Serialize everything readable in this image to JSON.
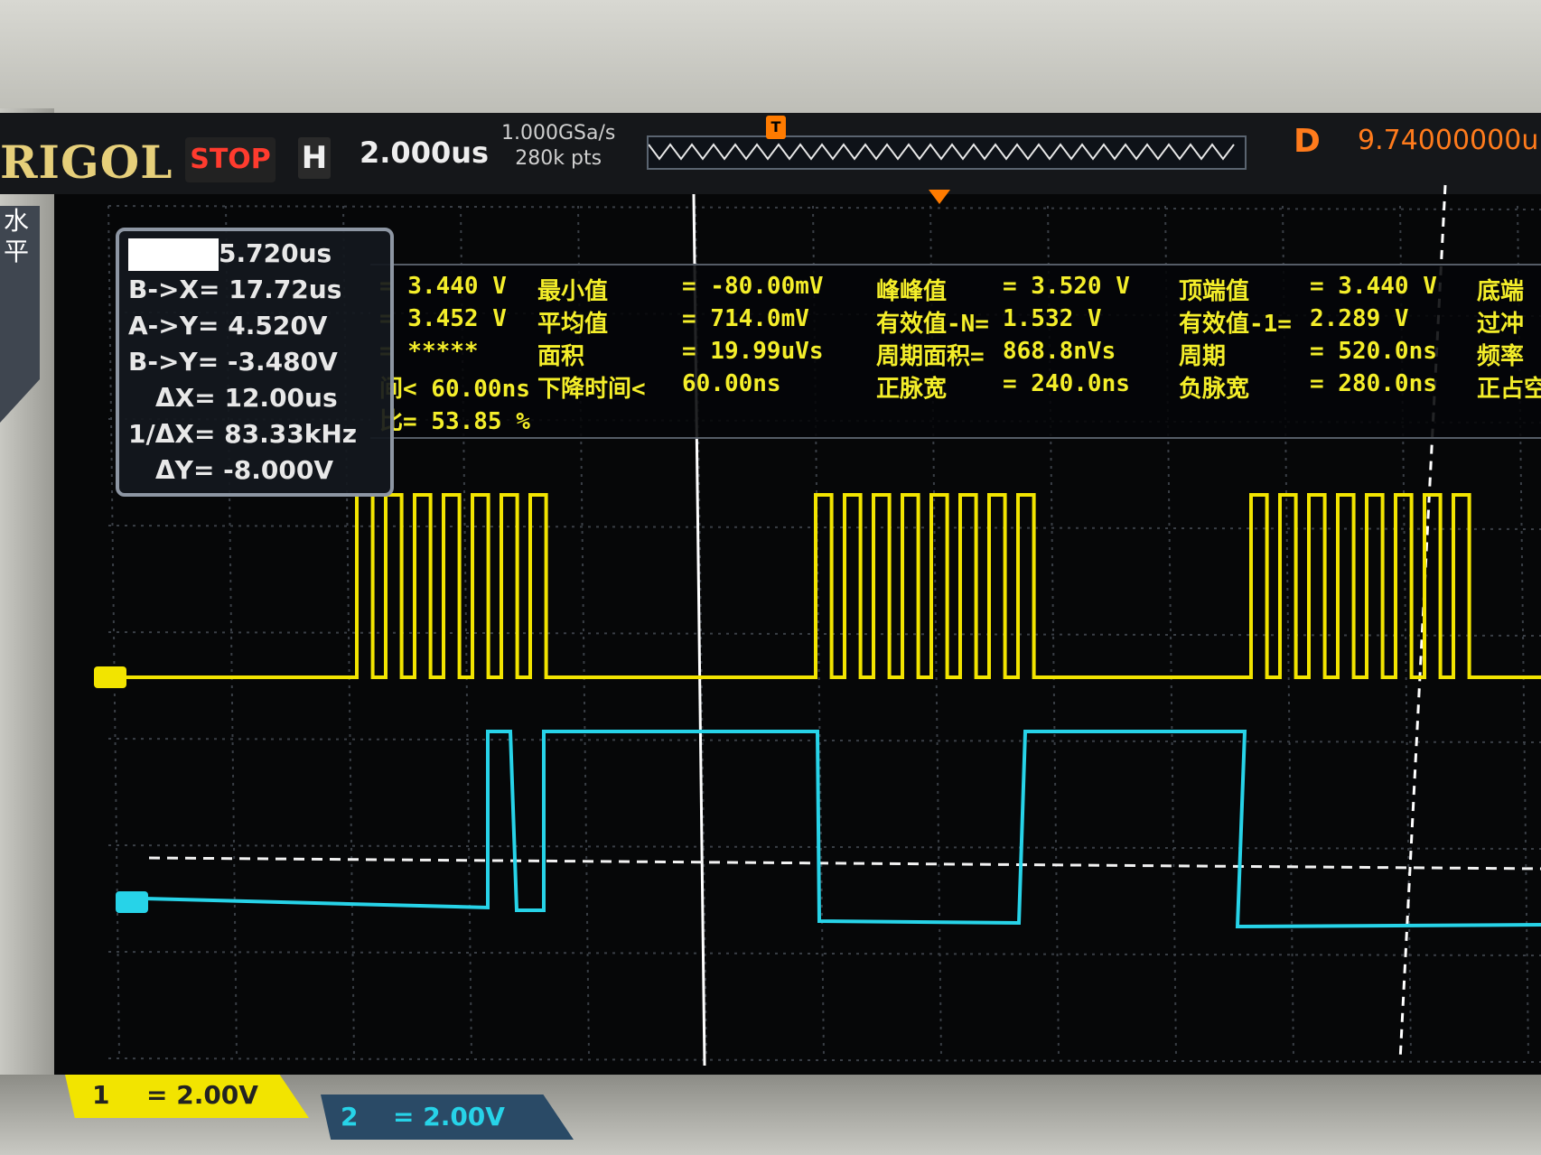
{
  "brand": "RIGOL",
  "run_state": "STOP",
  "horizontal_badge": "H",
  "timebase": "2.000us",
  "sample_rate": "1.000GSa/s",
  "memory_depth": "280k pts",
  "trigger_marker": "T",
  "delay_label": "D",
  "delay_value": "9.74000000u",
  "left_tab": "水\n平",
  "cursor_panel": {
    "first_value": "5.720us",
    "lines": [
      "B->X= 17.72us",
      "A->Y= 4.520V",
      "B->Y= -3.480V",
      "ΔX= 12.00us",
      "1/ΔX= 83.33kHz",
      "ΔY= -8.000V"
    ]
  },
  "measurements": [
    [
      "= 3.440 V",
      "最小值",
      "= -80.00mV",
      "峰峰值",
      "= 3.520 V",
      "顶端值",
      "= 3.440 V",
      "底端"
    ],
    [
      "= 3.452 V",
      "平均值",
      "= 714.0mV",
      "有效值-N=",
      "1.532 V",
      "有效值-1=",
      "2.289 V",
      "过冲"
    ],
    [
      "= *****",
      "面积",
      "= 19.99uVs",
      "周期面积=",
      "868.8nVs",
      "周期",
      "= 520.0ns",
      "频率"
    ],
    [
      "间< 60.00ns",
      "下降时间<",
      "60.00ns",
      "正脉宽",
      "= 240.0ns",
      "负脉宽",
      "= 280.0ns",
      "正占空"
    ],
    [
      "比= 53.85 %",
      "",
      "",
      "",
      "",
      "",
      "",
      ""
    ]
  ],
  "channel1": {
    "label": "1",
    "scale": "= 2.00V",
    "color": "#f2e400"
  },
  "channel2": {
    "label": "2",
    "scale": "= 2.00V",
    "color": "#27d3e8"
  }
}
